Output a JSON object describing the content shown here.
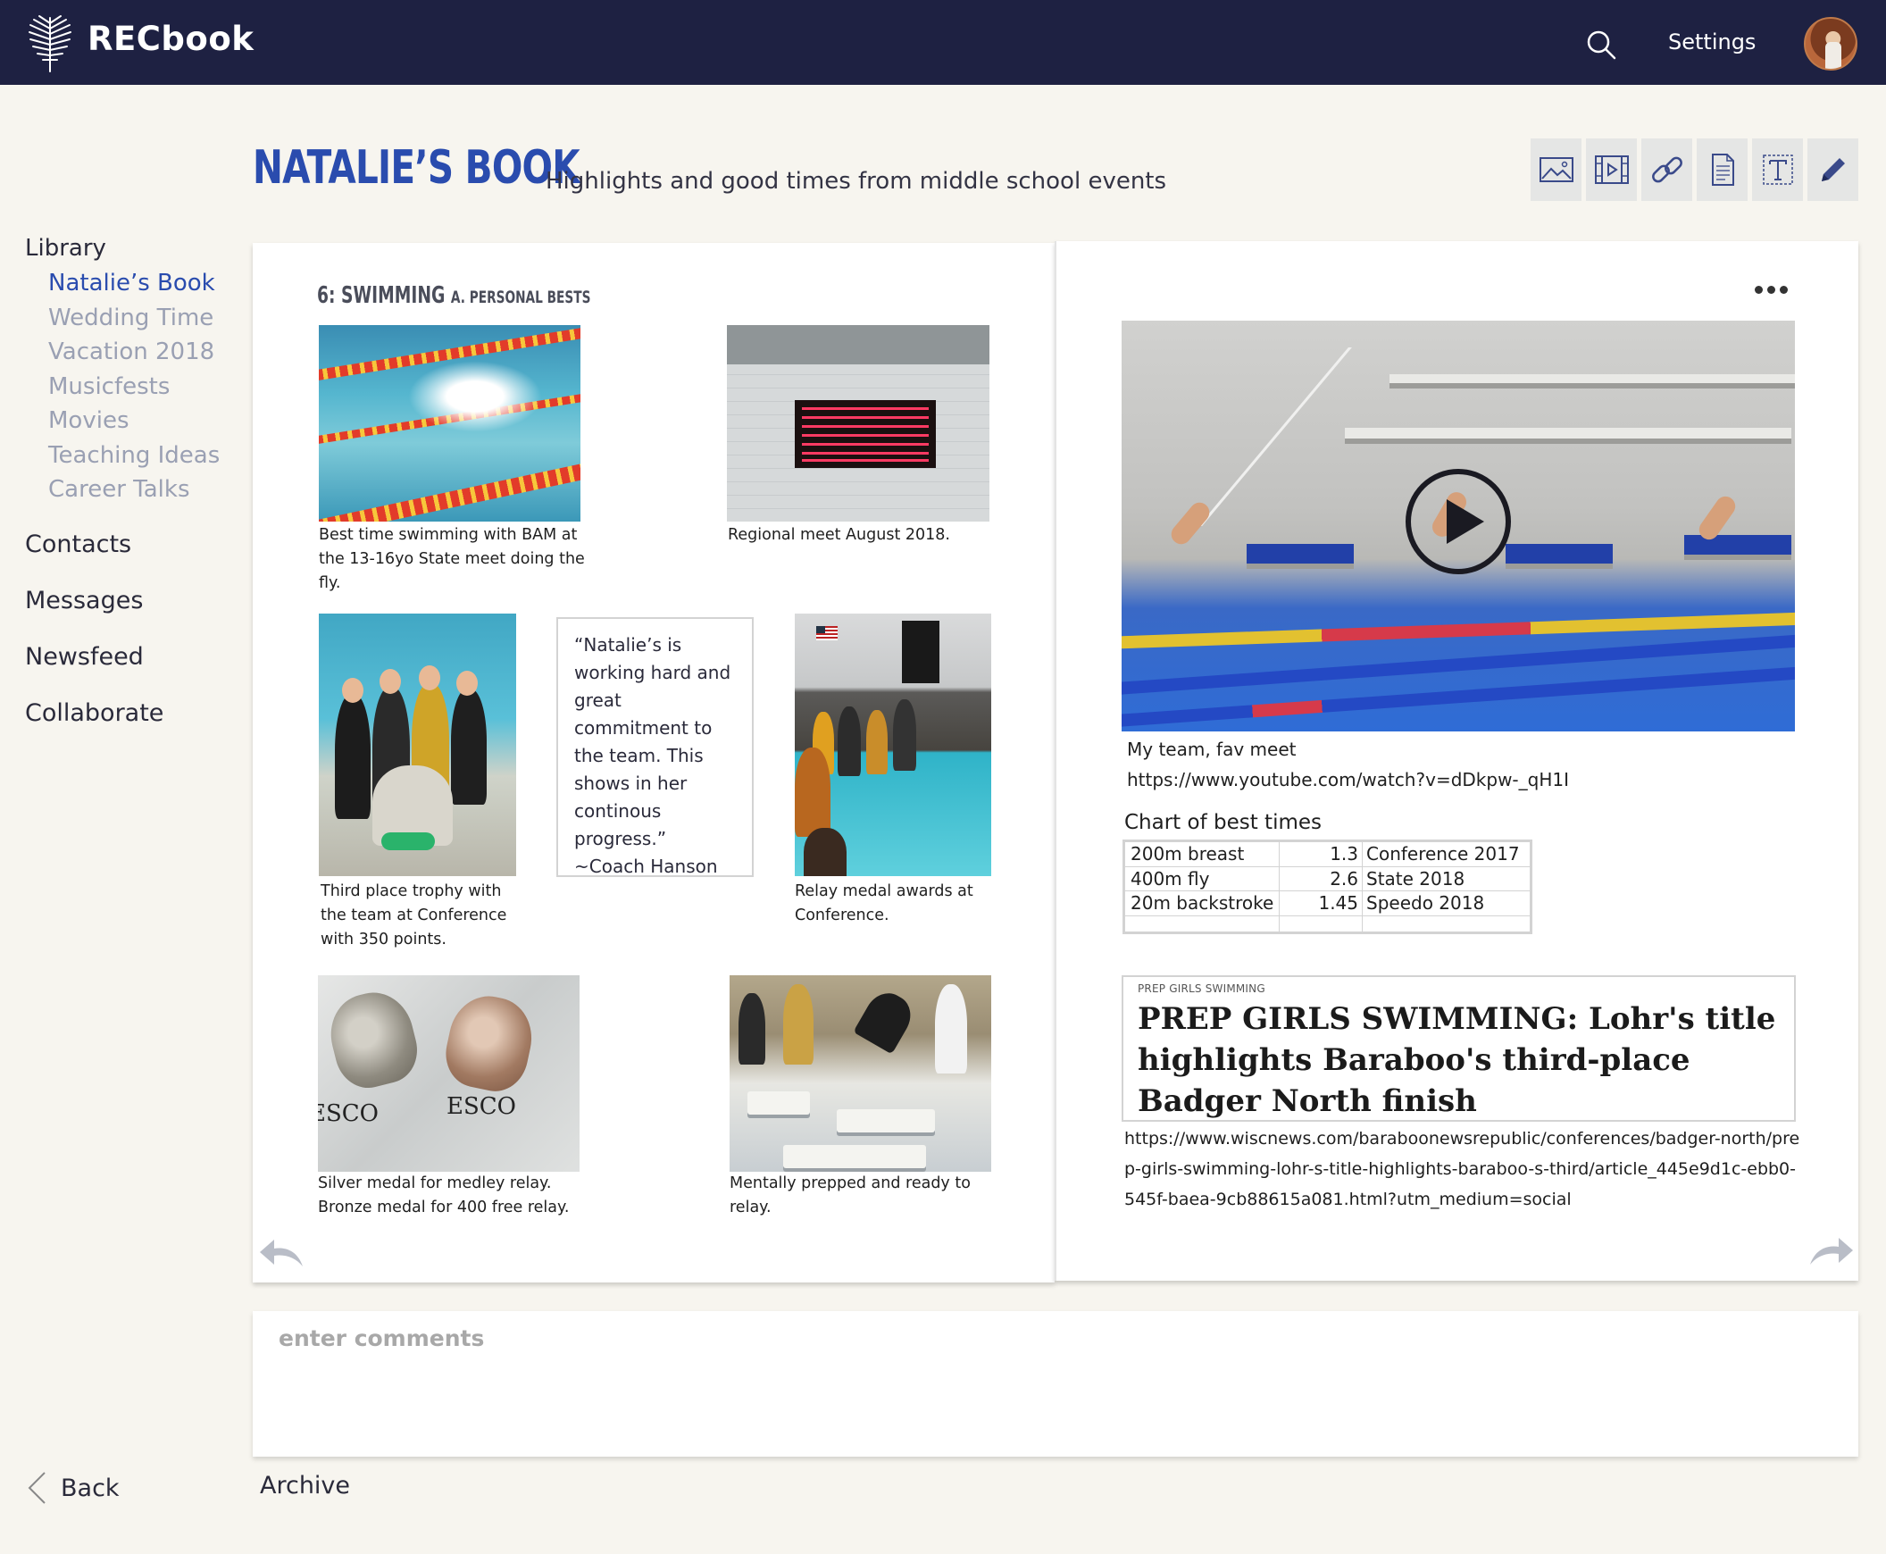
{
  "app": {
    "brand": "RECbook"
  },
  "header": {
    "settings_label": "Settings"
  },
  "book": {
    "title": "NATALIE’S BOOK",
    "subtitle": "Highlights and good times from middle school events"
  },
  "toolbar": {
    "tools": [
      "image-icon",
      "video-icon",
      "link-icon",
      "document-icon",
      "text-icon",
      "pencil-icon"
    ]
  },
  "sidebar": {
    "library_label": "Library",
    "library_items": [
      {
        "label": "Natalie’s Book",
        "active": true
      },
      {
        "label": "Wedding Time",
        "active": false
      },
      {
        "label": "Vacation 2018",
        "active": false
      },
      {
        "label": "Musicfests",
        "active": false
      },
      {
        "label": "Movies",
        "active": false
      },
      {
        "label": "Teaching Ideas",
        "active": false
      },
      {
        "label": "Career Talks",
        "active": false
      }
    ],
    "main_items": [
      "Contacts",
      "Messages",
      "Newsfeed",
      "Collaborate"
    ]
  },
  "left_page": {
    "section_title": "6: SWIMMING",
    "section_sub": "A. PERSONAL BESTS",
    "captions": [
      "Best time swimming with BAM at the 13-16yo State meet doing the fly.",
      "Regional meet August 2018.",
      "Third place trophy with the team at Conference with 350 points.",
      "Relay medal awards at Conference.",
      "Silver medal for medley relay. Bronze medal for 400 free relay.",
      "Mentally prepped and ready to relay."
    ],
    "quote": "“Natalie’s is working hard and great commitment to the team.  This shows in her continous progress.” ~Coach Hanson",
    "medal_text": "ESCO"
  },
  "right_page": {
    "video_caption": "My team, fav meet",
    "video_url": "https://www.youtube.com/watch?v=dDkpw-_qH1I",
    "chart_title": "Chart of best times",
    "best_times": [
      {
        "event": "200m breast",
        "time": "1.3",
        "meet": "Conference 2017"
      },
      {
        "event": "400m fly",
        "time": "2.6",
        "meet": "State 2018"
      },
      {
        "event": "20m backstroke",
        "time": "1.45",
        "meet": "Speedo 2018"
      },
      {
        "event": "",
        "time": "",
        "meet": ""
      }
    ],
    "news": {
      "kicker": "PREP GIRLS SWIMMING",
      "headline": "PREP GIRLS SWIMMING: Lohr's title highlights Baraboo's third-place Badger North finish",
      "url": "https://www.wiscnews.com/baraboonewsrepublic/conferences/badger-north/prep-girls-swimming-lohr-s-title-highlights-baraboo-s-third/article_445e9d1c-ebb0-545f-baea-9cb88615a081.html?utm_medium=social"
    }
  },
  "comments": {
    "placeholder": "enter comments"
  },
  "footer": {
    "back_label": "Back",
    "archive_label": "Archive"
  },
  "colors": {
    "navbar": "#1e2142",
    "accent": "#2a4cae",
    "muted": "#9aa0b3"
  }
}
